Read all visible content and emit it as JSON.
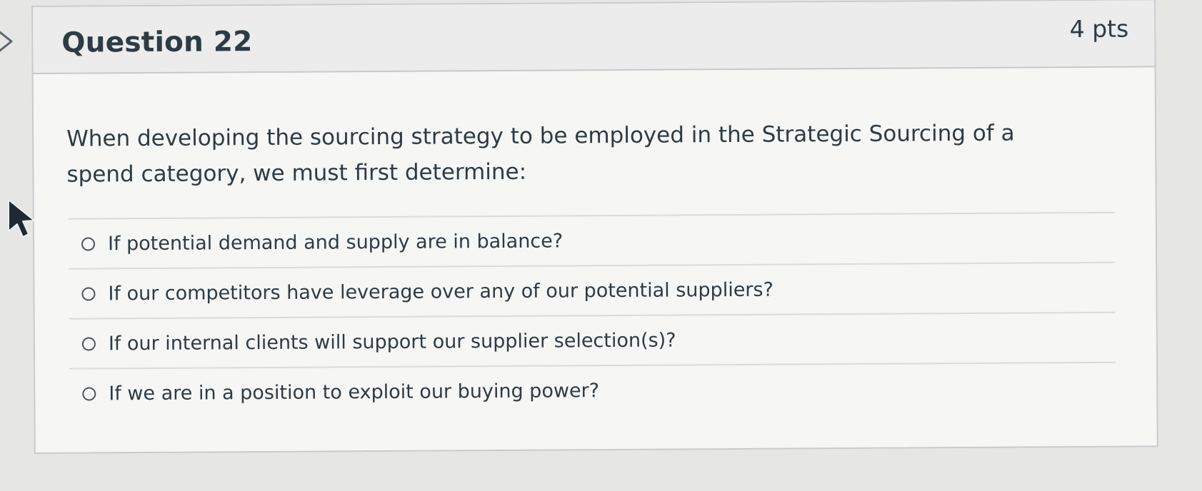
{
  "question": {
    "title": "Question 22",
    "points": "4 pts",
    "text": "When developing the sourcing strategy to be employed in the Strategic Sourcing of a spend category, we must first determine:",
    "answers": [
      {
        "label": "If potential demand and supply are in balance?"
      },
      {
        "label": "If our competitors have leverage over any of our potential suppliers?"
      },
      {
        "label": "If our internal clients will support our supplier selection(s)?"
      },
      {
        "label": "If we are in a position to exploit our buying power?"
      }
    ]
  },
  "icons": {
    "nav": "chevron-right-icon",
    "cursor": "mouse-pointer-icon"
  }
}
